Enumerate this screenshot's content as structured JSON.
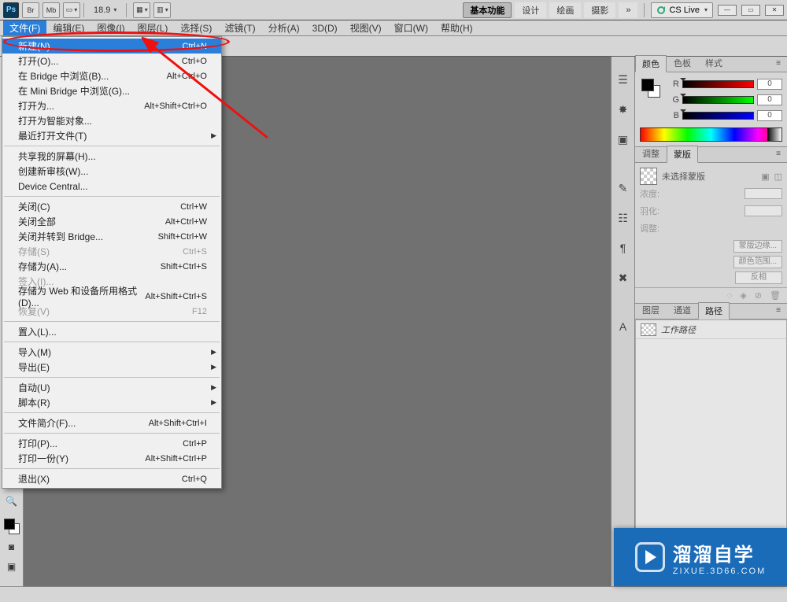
{
  "appbar": {
    "zoom": "18.9",
    "workspace_buttons": [
      "基本功能",
      "设计",
      "绘画",
      "摄影"
    ],
    "cs_live": "CS Live"
  },
  "menubar": [
    "文件(F)",
    "编辑(E)",
    "图像(I)",
    "图层(L)",
    "选择(S)",
    "滤镜(T)",
    "分析(A)",
    "3D(D)",
    "视图(V)",
    "窗口(W)",
    "帮助(H)"
  ],
  "file_menu": [
    {
      "label": "新建(N)...",
      "shortcut": "Ctrl+N",
      "hl": true
    },
    {
      "label": "打开(O)...",
      "shortcut": "Ctrl+O"
    },
    {
      "label": "在 Bridge 中浏览(B)...",
      "shortcut": "Alt+Ctrl+O"
    },
    {
      "label": "在 Mini Bridge 中浏览(G)..."
    },
    {
      "label": "打开为...",
      "shortcut": "Alt+Shift+Ctrl+O"
    },
    {
      "label": "打开为智能对象..."
    },
    {
      "label": "最近打开文件(T)",
      "sub": true
    },
    {
      "sep": true
    },
    {
      "label": "共享我的屏幕(H)..."
    },
    {
      "label": "创建新审核(W)..."
    },
    {
      "label": "Device Central..."
    },
    {
      "sep": true
    },
    {
      "label": "关闭(C)",
      "shortcut": "Ctrl+W"
    },
    {
      "label": "关闭全部",
      "shortcut": "Alt+Ctrl+W"
    },
    {
      "label": "关闭并转到 Bridge...",
      "shortcut": "Shift+Ctrl+W"
    },
    {
      "label": "存储(S)",
      "shortcut": "Ctrl+S",
      "dis": true
    },
    {
      "label": "存储为(A)...",
      "shortcut": "Shift+Ctrl+S"
    },
    {
      "label": "签入(I)...",
      "dis": true
    },
    {
      "label": "存储为 Web 和设备所用格式(D)...",
      "shortcut": "Alt+Shift+Ctrl+S"
    },
    {
      "label": "恢复(V)",
      "shortcut": "F12",
      "dis": true
    },
    {
      "sep": true
    },
    {
      "label": "置入(L)..."
    },
    {
      "sep": true
    },
    {
      "label": "导入(M)",
      "sub": true
    },
    {
      "label": "导出(E)",
      "sub": true
    },
    {
      "sep": true
    },
    {
      "label": "自动(U)",
      "sub": true
    },
    {
      "label": "脚本(R)",
      "sub": true
    },
    {
      "sep": true
    },
    {
      "label": "文件简介(F)...",
      "shortcut": "Alt+Shift+Ctrl+I"
    },
    {
      "sep": true
    },
    {
      "label": "打印(P)...",
      "shortcut": "Ctrl+P"
    },
    {
      "label": "打印一份(Y)",
      "shortcut": "Alt+Shift+Ctrl+P"
    },
    {
      "sep": true
    },
    {
      "label": "退出(X)",
      "shortcut": "Ctrl+Q"
    }
  ],
  "panels": {
    "color_tabs": [
      "颜色",
      "色板",
      "样式"
    ],
    "rgb": {
      "r_label": "R",
      "g_label": "G",
      "b_label": "B",
      "r": "0",
      "g": "0",
      "b": "0"
    },
    "mask_tabs": [
      "调整",
      "蒙版"
    ],
    "mask_title": "未选择蒙版",
    "mask_rows": {
      "density": "浓度:",
      "feather": "羽化:",
      "adjust": "调整:"
    },
    "mask_buttons": {
      "edge": "蒙版边缘...",
      "range": "颜色范围...",
      "invert": "反相"
    },
    "paths_tabs": [
      "图层",
      "通道",
      "路径"
    ],
    "paths_item": "工作路径"
  },
  "watermark": {
    "big": "溜溜自学",
    "small": "ZIXUE.3D66.COM"
  },
  "optbar": {
    "ghost1": "· · · · ·",
    "ghost2": "ᆖ ᆖ ᆖ",
    "ghost3": "ᆗ ᆗ ᆗ",
    "ghost4": "⊪ ⋯ ⋯"
  }
}
